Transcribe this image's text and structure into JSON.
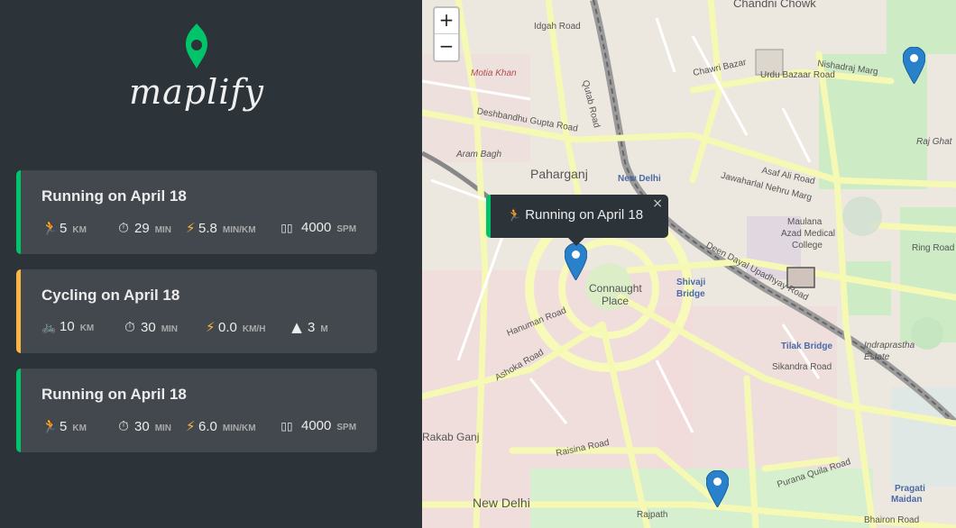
{
  "app": {
    "name": "maplify"
  },
  "workouts": [
    {
      "type": "running",
      "title": "Running on April 18",
      "distance": {
        "value": "5",
        "unit": "km"
      },
      "duration": {
        "value": "29",
        "unit": "min"
      },
      "rate": {
        "value": "5.8",
        "unit": "min/km"
      },
      "extra": {
        "value": "4000",
        "unit": "spm",
        "icon": "footprints-icon",
        "glyph": "▯▯"
      }
    },
    {
      "type": "cycling",
      "title": "Cycling on April 18",
      "distance": {
        "value": "10",
        "unit": "km"
      },
      "duration": {
        "value": "30",
        "unit": "min"
      },
      "rate": {
        "value": "0.0",
        "unit": "km/h"
      },
      "extra": {
        "value": "3",
        "unit": "m",
        "icon": "mountain-icon",
        "glyph": "▲"
      }
    },
    {
      "type": "running",
      "title": "Running on April 18",
      "distance": {
        "value": "5",
        "unit": "km"
      },
      "duration": {
        "value": "30",
        "unit": "min"
      },
      "rate": {
        "value": "6.0",
        "unit": "min/km"
      },
      "extra": {
        "value": "4000",
        "unit": "spm",
        "icon": "footprints-icon",
        "glyph": "▯▯"
      }
    }
  ],
  "map": {
    "zoom_in": "+",
    "zoom_out": "−",
    "popup": {
      "text": "Running on April 18",
      "close": "×"
    },
    "labels": {
      "chandni_chowk": "Chandni Chowk",
      "paharganj": "Paharganj",
      "new_delhi": "New Delhi",
      "connaught": "Connaught",
      "place": "Place",
      "shivaji": "Shivaji",
      "bridge": "Bridge",
      "maulana": "Maulana",
      "azad_medical": "Azad Medical",
      "college": "College",
      "tilak_bridge": "Tilak Bridge",
      "indraprastha": "Indraprastha",
      "estate": "Estate",
      "rakab_ganj": "Rakab Ganj",
      "new_delhi_bottom": "New Delhi",
      "pragati": "Pragati",
      "maidan": "Maidan",
      "raj_ghat": "Raj Ghat",
      "motia_khan": "Motia Khan",
      "aram_bagh": "Aram Bagh",
      "asaf_ali_road": "Asaf Ali Road",
      "jawaharlal_nehru_marg": "Jawaharlal Nehru Marg",
      "ring_road": "Ring Road",
      "deen_dayal": "Deen Dayal Upadhyay Road",
      "sikandra_road": "Sikandra Road",
      "ashoka_road": "Ashoka Road",
      "raisina_road": "Raisina Road",
      "rajpath": "Rajpath",
      "purana_quila": "Purana Quila Road",
      "bhairon_road": "Bhairon Road",
      "hanuman_road": "Hanuman Road",
      "deshbandhu": "Deshbandhu Gupta Road",
      "nishadraj_marg": "Nishadraj Marg",
      "urdu_bazaar": "Urdu Bazaar Road",
      "chawri_bazar": "Chawri Bazar",
      "idgah_road": "Idgah Road",
      "qutab_road": "Qutab Road"
    }
  },
  "colors": {
    "running": "#00c46a",
    "cycling": "#ffb545",
    "marker": "#2a81cb",
    "logo": "#00c46a"
  }
}
